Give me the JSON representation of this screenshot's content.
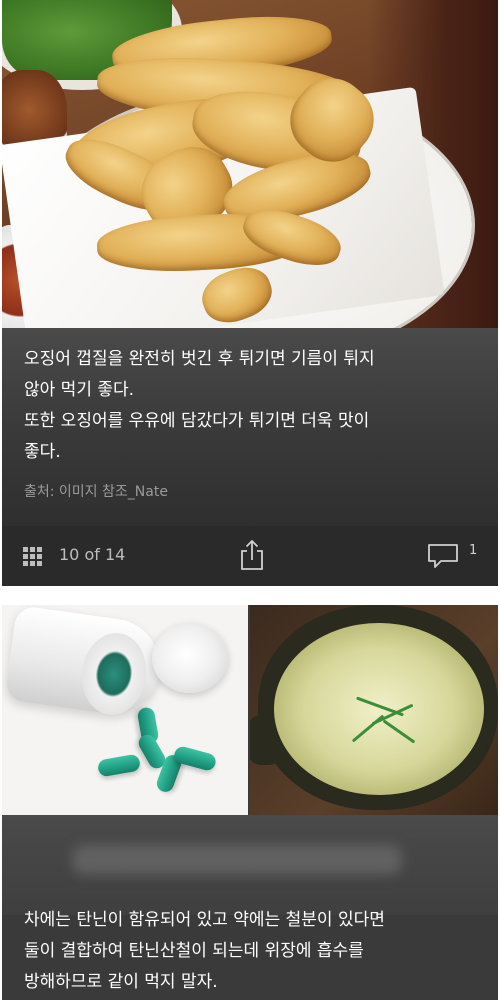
{
  "card1": {
    "caption_lines": [
      "오징어 껍질을 완전히 벗긴 후 튀기면 기름이 튀지",
      "않아 먹기 좋다.",
      "또한 오징어를 우유에 담갔다가 튀기면 더욱 맛이",
      "좋다."
    ],
    "source": "출처: 이미지 참조_Nate",
    "toolbar": {
      "counter": "10 of 14",
      "comment_count": "1",
      "icons": [
        "grid-icon",
        "share-icon",
        "comment-icon"
      ]
    }
  },
  "card2": {
    "caption_lines": [
      "차에는 탄닌이 함유되어 있고 약에는 철분이 있다면",
      "둘이 결합하여 탄닌산철이 되는데 위장에 흡수를",
      "방해하므로 같이 먹지 말자."
    ]
  },
  "colors": {
    "card_bg": "#2b2b2b",
    "caption_text": "#ffffff",
    "muted_text": "#9a9a9a",
    "icon": "#bdbdbd"
  }
}
